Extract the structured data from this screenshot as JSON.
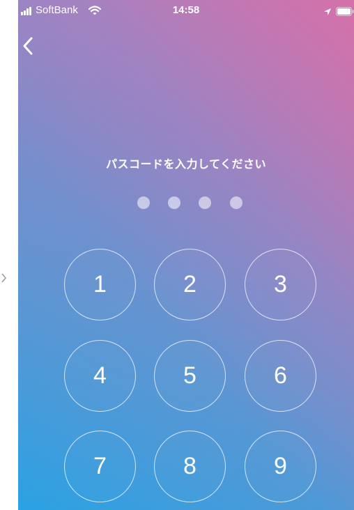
{
  "status_bar": {
    "carrier": "SoftBank",
    "time": "14:58",
    "icons": [
      "signal-icon",
      "wifi-icon",
      "location-icon",
      "battery-icon"
    ]
  },
  "nav": {
    "back_icon": "chevron-left-icon"
  },
  "passcode": {
    "prompt": "パスコードを入力してください",
    "digits_entered": 0,
    "digits_total": 4
  },
  "keypad": {
    "keys": [
      "1",
      "2",
      "3",
      "4",
      "5",
      "6",
      "7",
      "8",
      "9"
    ]
  },
  "colors": {
    "gradient_top_right": "#d670a8",
    "gradient_bottom_left": "#2aa2e3",
    "text": "#ffffff"
  }
}
